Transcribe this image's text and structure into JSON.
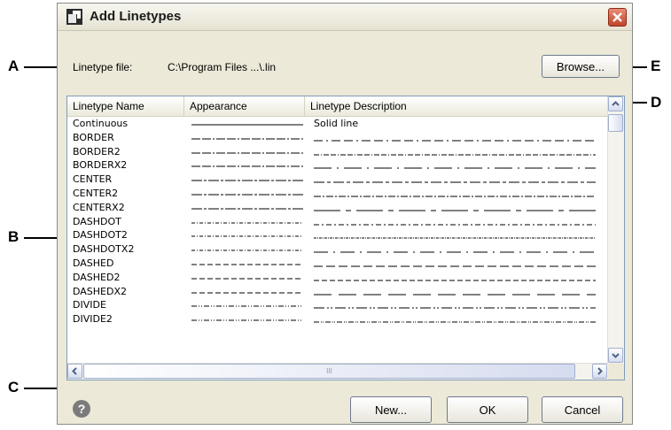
{
  "window": {
    "title": "Add Linetypes"
  },
  "linetype_file": {
    "label": "Linetype file:",
    "path": "C:\\Program Files ...\\.lin"
  },
  "buttons": {
    "browse": "Browse...",
    "new": "New...",
    "ok": "OK",
    "cancel": "Cancel",
    "help": "?"
  },
  "table": {
    "headers": [
      "Linetype Name",
      "Appearance",
      "Linetype Description"
    ],
    "rows": [
      {
        "name": "Continuous",
        "appearance": "solid",
        "description": "Solid line"
      },
      {
        "name": "BORDER",
        "appearance": "border",
        "description": ""
      },
      {
        "name": "BORDER2",
        "appearance": "border",
        "description": ""
      },
      {
        "name": "BORDERX2",
        "appearance": "border",
        "description": ""
      },
      {
        "name": "CENTER",
        "appearance": "center",
        "description": ""
      },
      {
        "name": "CENTER2",
        "appearance": "center",
        "description": ""
      },
      {
        "name": "CENTERX2",
        "appearance": "center",
        "description": ""
      },
      {
        "name": "DASHDOT",
        "appearance": "dashdot",
        "description": ""
      },
      {
        "name": "DASHDOT2",
        "appearance": "dashdot",
        "description": ""
      },
      {
        "name": "DASHDOTX2",
        "appearance": "dashdot",
        "description": ""
      },
      {
        "name": "DASHED",
        "appearance": "dashed",
        "description": ""
      },
      {
        "name": "DASHED2",
        "appearance": "dashed",
        "description": ""
      },
      {
        "name": "DASHEDX2",
        "appearance": "dashed",
        "description": ""
      },
      {
        "name": "DIVIDE",
        "appearance": "divide",
        "description": ""
      },
      {
        "name": "DIVIDE2",
        "appearance": "divide",
        "description": ""
      }
    ],
    "horizontal_scroll_grip": "III"
  },
  "callouts": [
    "A",
    "B",
    "C",
    "D",
    "E"
  ],
  "colors": {
    "dialog_bg": "#ece9d8",
    "close_red": "#c1442a",
    "list_border": "#7f9db9"
  }
}
